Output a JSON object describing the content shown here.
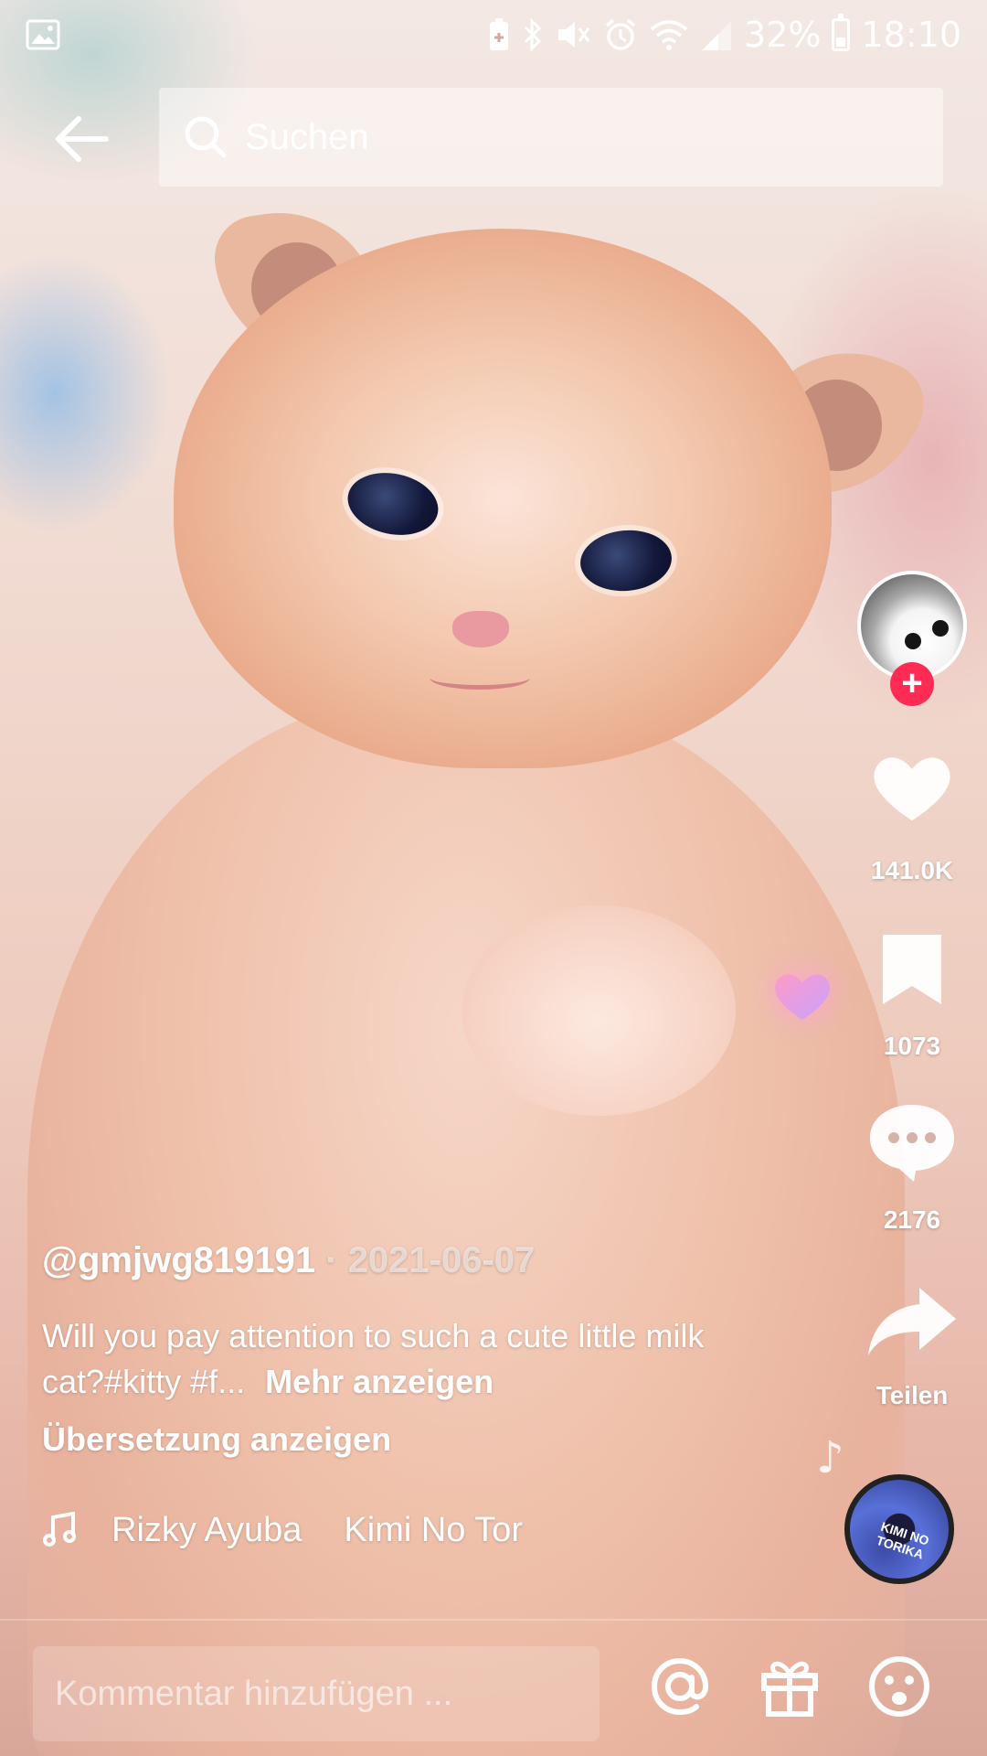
{
  "status_bar": {
    "battery": "32%",
    "time": "18:10",
    "icons": [
      "image-icon",
      "battery-saver-icon",
      "bluetooth-icon",
      "mute-icon",
      "alarm-icon",
      "wifi-icon",
      "signal-icon"
    ]
  },
  "search": {
    "placeholder": "Suchen"
  },
  "video": {
    "author": "@gmjwg819191",
    "separator": " · ",
    "date": "2021-06-07",
    "description": "Will you pay attention to such a cute little milk cat?#kitty #f...",
    "more_label": "Mehr anzeigen",
    "translate_label": "Übersetzung anzeigen",
    "music_artist": "Rizky Ayuba",
    "music_title": "Kimi No Tor"
  },
  "actions": {
    "likes": "141.0K",
    "bookmarks": "1073",
    "comments": "2176",
    "share_label": "Teilen",
    "follow_symbol": "+"
  },
  "disc": {
    "art_text": "KIMI NO TORIKA"
  },
  "comment_bar": {
    "placeholder": "Kommentar hinzufügen ..."
  },
  "colors": {
    "follow_red": "#fe2c55",
    "overlay_white": "#ffffff"
  }
}
